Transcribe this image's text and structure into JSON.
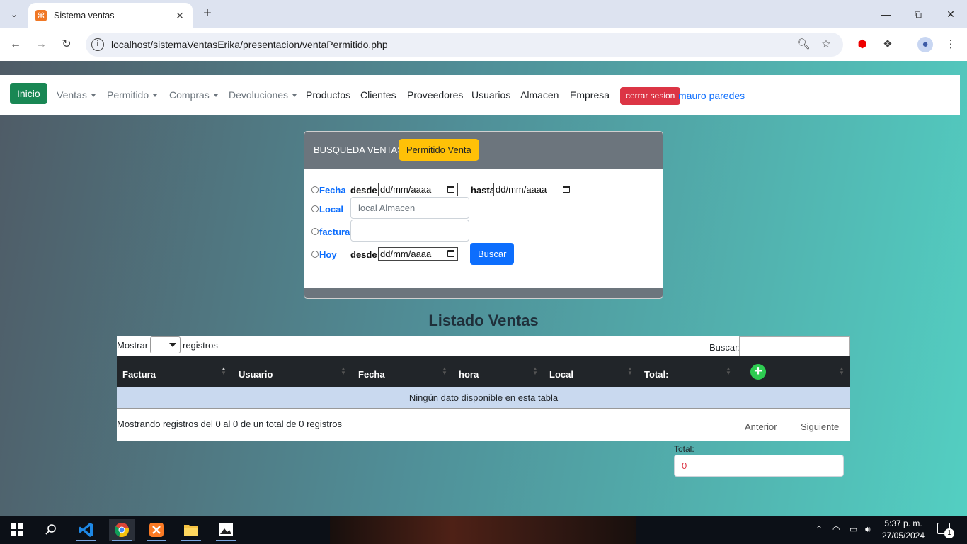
{
  "browser": {
    "tab_title": "Sistema ventas",
    "url": "localhost/sistemaVentasErika/presentacion/ventaPermitido.php"
  },
  "navbar": {
    "inicio": "Inicio",
    "ventas": "Ventas",
    "permitido": "Permitido",
    "compras": "Compras",
    "devoluciones": "Devoluciones",
    "productos": "Productos",
    "clientes": "Clientes",
    "proveedores": "Proveedores",
    "usuarios": "Usuarios",
    "almacen": "Almacen",
    "empresa": "Empresa",
    "cerrar_sesion": "cerrar sesion",
    "user": "mauro paredes"
  },
  "search_card": {
    "title": "BUSQUEDA VENTAS",
    "permitido_button": "Permitido Venta",
    "fecha_label": "Fecha",
    "desde_label": "desde",
    "hasta_label": "hasta",
    "date_placeholder": "dd/mm/aaaa",
    "local_label": "Local",
    "local_placeholder": "local Almacen",
    "factura_label": "factura",
    "factura_value": "",
    "hoy_label": "Hoy",
    "buscar_button": "Buscar"
  },
  "listado": {
    "title": "Listado Ventas",
    "mostrar_label": "Mostrar",
    "registros_label": "registros",
    "buscar_label": "Buscar:",
    "columns": [
      "Factura",
      "Usuario",
      "Fecha",
      "hora",
      "Local",
      "Total:"
    ],
    "empty_message": "Ningún dato disponible en esta tabla",
    "info": "Mostrando registros del 0 al 0 de un total de 0 registros",
    "anterior": "Anterior",
    "siguiente": "Siguiente",
    "total_label": "Total:",
    "total_value": "0"
  },
  "taskbar": {
    "time": "5:37 p. m.",
    "date": "27/05/2024",
    "notification_count": "1"
  },
  "colors": {
    "inicio_green": "#198754",
    "cerrar_red": "#dc3545",
    "permitido_yellow": "#ffc107",
    "buscar_blue": "#0d6efd",
    "table_header": "#212529",
    "add_green": "#2ecc51"
  }
}
